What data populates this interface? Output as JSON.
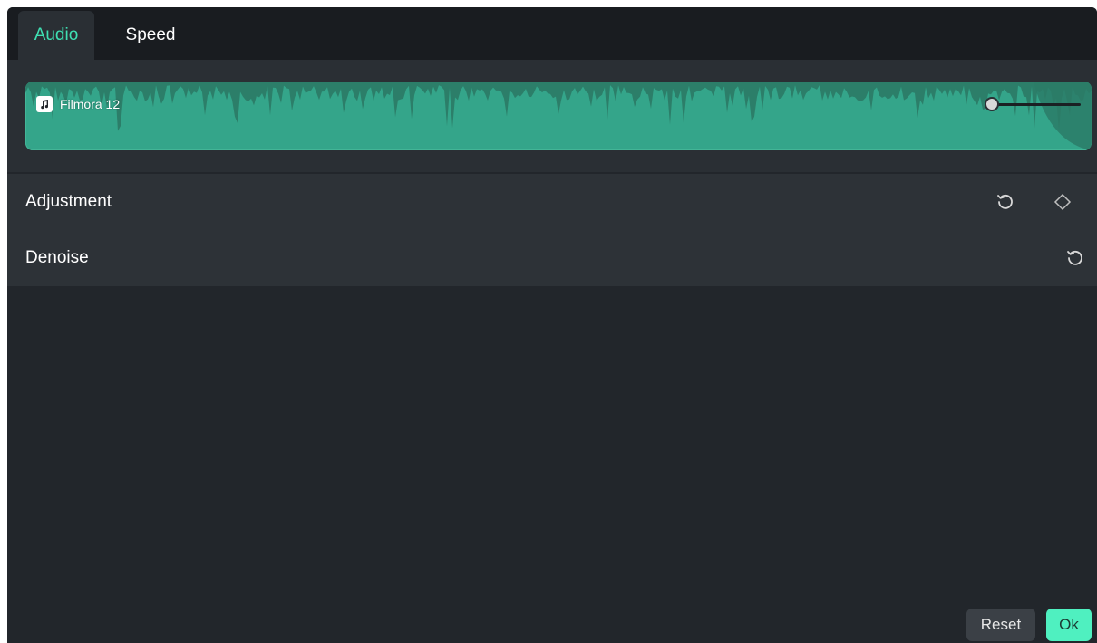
{
  "tabs": [
    {
      "label": "Audio",
      "active": true
    },
    {
      "label": "Speed",
      "active": false
    }
  ],
  "clip": {
    "name": "Filmora 12",
    "icon": "music-note-icon",
    "color": "#34a58a"
  },
  "sections": {
    "adjustment": {
      "label": "Adjustment",
      "reset_icon": "reset-icon",
      "keyframe_icon": "keyframe-diamond-icon"
    },
    "denoise": {
      "label": "Denoise",
      "reset_icon": "reset-icon"
    }
  },
  "footer": {
    "reset_label": "Reset",
    "ok_label": "Ok"
  },
  "colors": {
    "accent": "#3fe0b3",
    "ok_button": "#4ff0c0",
    "panel": "#22262b"
  }
}
